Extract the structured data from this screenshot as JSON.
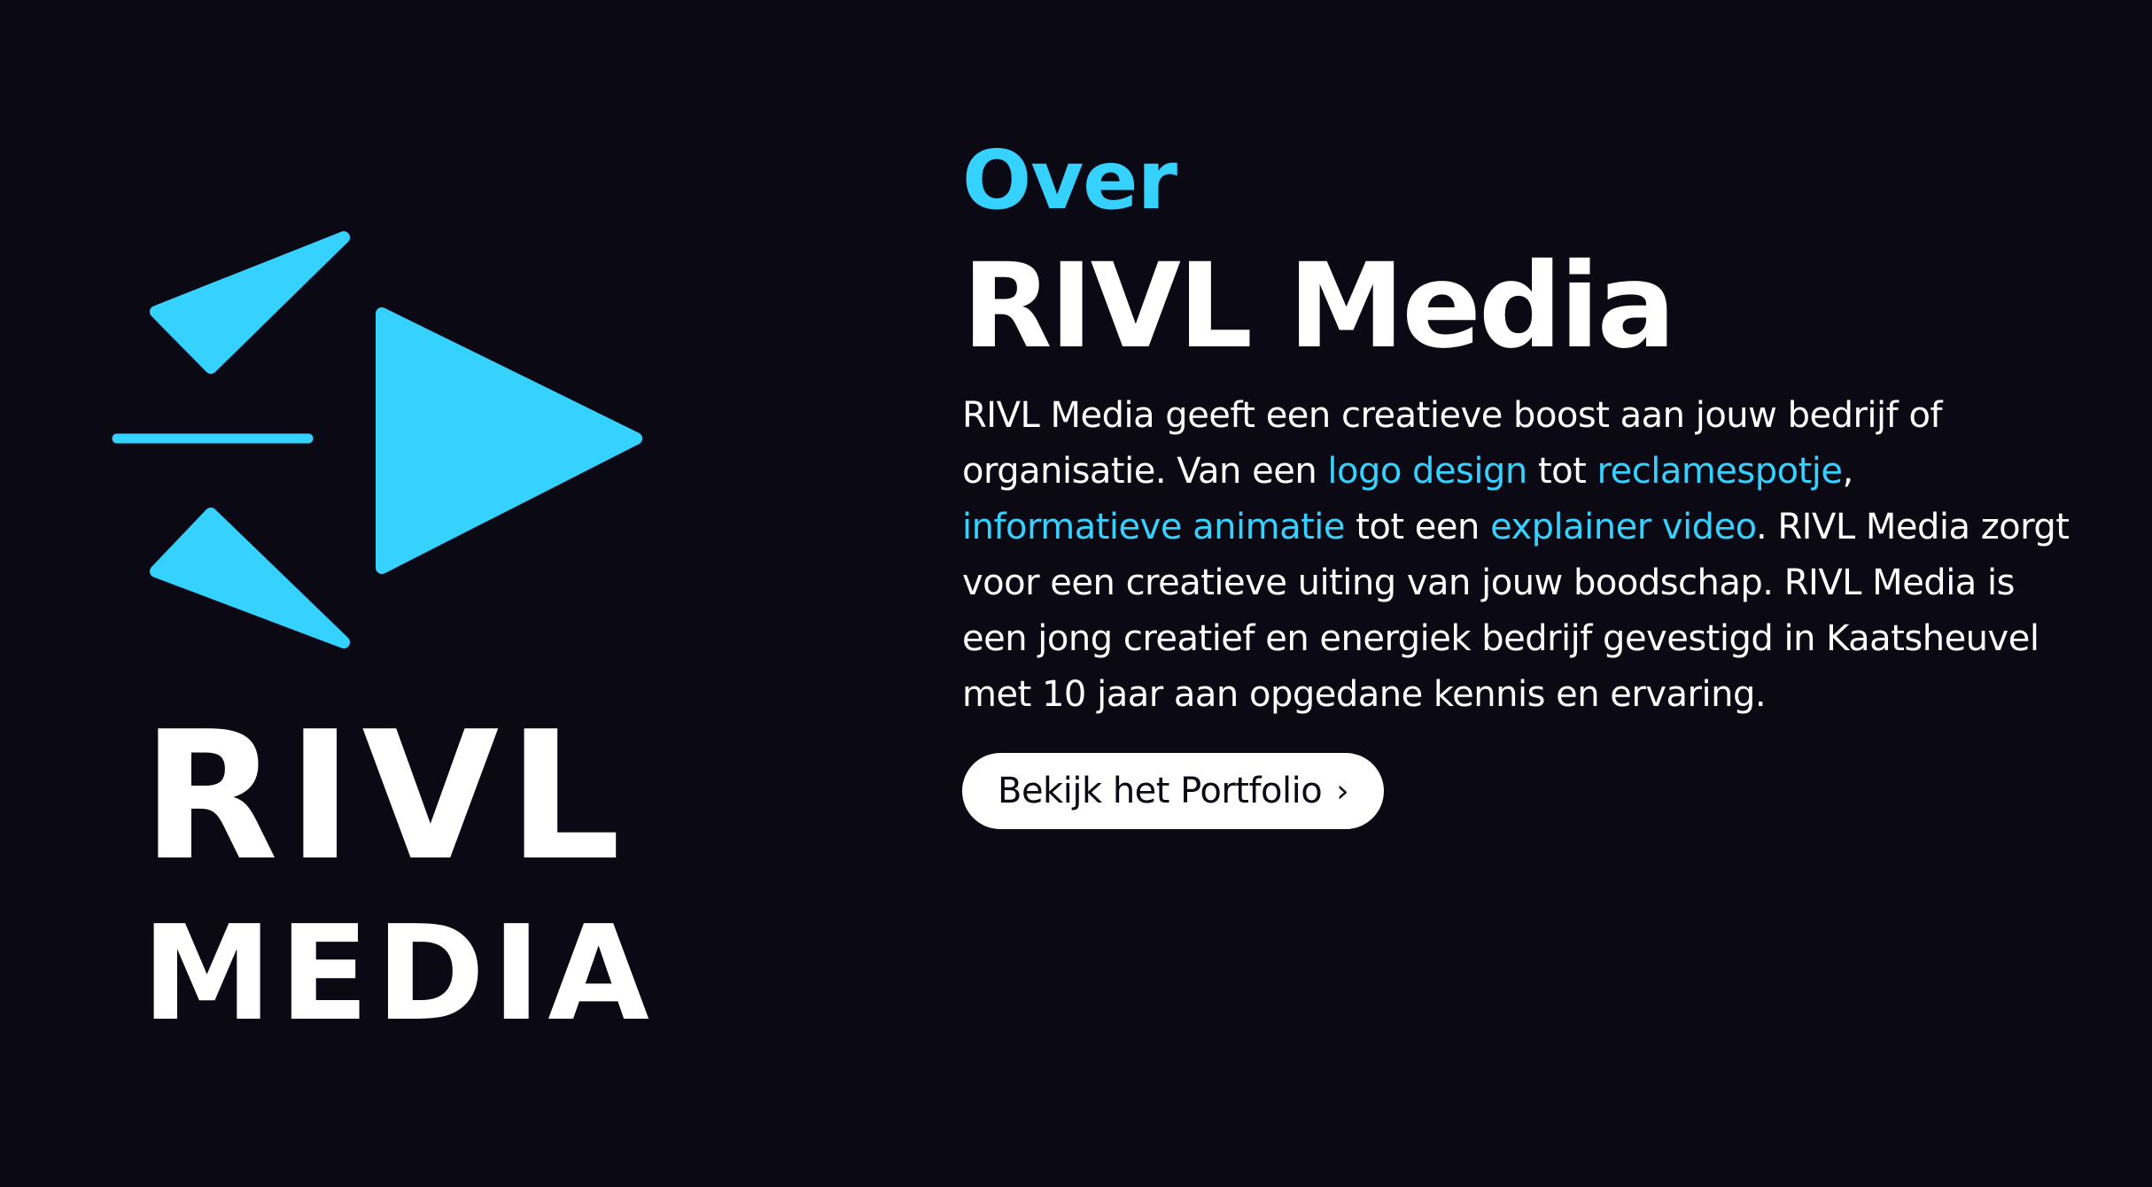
{
  "brand": {
    "accent_color": "#35d1ff",
    "background_color": "#0b0a14",
    "logo_line1": "RIVL",
    "logo_line2": "MEDIA"
  },
  "about": {
    "kicker": "Over",
    "title": "RIVL Media",
    "paragraph": {
      "p1": "RIVL Media geeft een creatieve boost aan jouw bedrijf of organisatie. Van een ",
      "link1": "logo design",
      "p2": " tot ",
      "link2": "reclamespotje",
      "p3": ", ",
      "link3": "informatieve animatie",
      "p4": " tot een ",
      "link4": "explainer video",
      "p5": ". RIVL Media zorgt voor een creatieve uiting van jouw boodschap. RIVL Media is een jong creatief en energiek bedrijf gevestigd in Kaatsheuvel met 10 jaar aan opgedane kennis en ervaring."
    },
    "cta_label": "Bekijk het Portfolio",
    "cta_icon": "chevron-right-icon",
    "cta_chevron": "›"
  }
}
